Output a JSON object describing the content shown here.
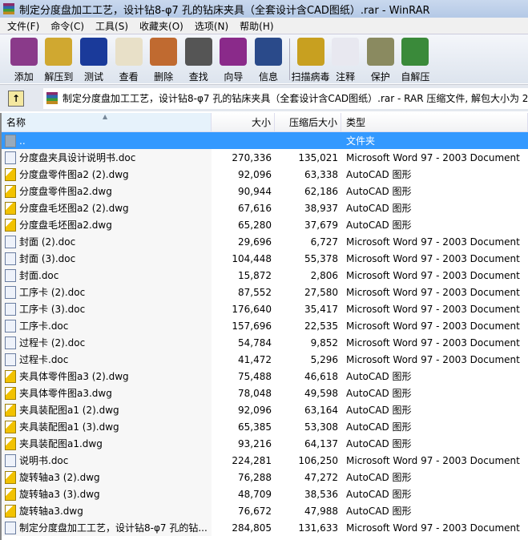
{
  "window": {
    "title": "制定分度盘加工工艺，设计钻8-φ7 孔的钻床夹具（全套设计含CAD图纸）.rar - WinRAR"
  },
  "menu": [
    "文件(F)",
    "命令(C)",
    "工具(S)",
    "收藏夹(O)",
    "选项(N)",
    "帮助(H)"
  ],
  "toolbar": [
    {
      "label": "添加",
      "icon": "add-archive-icon",
      "color": "#8a3a8a"
    },
    {
      "label": "解压到",
      "icon": "extract-icon",
      "color": "#d0a830"
    },
    {
      "label": "测试",
      "icon": "test-icon",
      "color": "#1a3a9a"
    },
    {
      "label": "查看",
      "icon": "view-icon",
      "color": "#e8e0c8"
    },
    {
      "label": "删除",
      "icon": "delete-icon",
      "color": "#c06a30"
    },
    {
      "label": "查找",
      "icon": "find-icon",
      "color": "#555"
    },
    {
      "label": "向导",
      "icon": "wizard-icon",
      "color": "#8a2a8a"
    },
    {
      "label": "信息",
      "icon": "info-icon",
      "color": "#2a4a8a"
    },
    {
      "label": "扫描病毒",
      "icon": "virus-scan-icon",
      "color": "#c8a020"
    },
    {
      "label": "注释",
      "icon": "comment-icon",
      "color": "#e8e8f0"
    },
    {
      "label": "保护",
      "icon": "protect-icon",
      "color": "#8a8a60"
    },
    {
      "label": "自解压",
      "icon": "sfx-icon",
      "color": "#3a8a3a"
    }
  ],
  "address": {
    "text": "制定分度盘加工工艺，设计钻8-φ7 孔的钻床夹具（全套设计含CAD图纸）.rar - RAR 压缩文件, 解包大小为 2"
  },
  "columns": {
    "name": "名称",
    "size": "大小",
    "packed": "压缩后大小",
    "type": "类型"
  },
  "files": [
    {
      "name": "..",
      "size": "",
      "packed": "",
      "type": "文件夹",
      "kind": "dir",
      "selected": true
    },
    {
      "name": "分度盘夹具设计说明书.doc",
      "size": "270,336",
      "packed": "135,021",
      "type": "Microsoft Word 97 - 2003 Document",
      "kind": "doc"
    },
    {
      "name": "分度盘零件图a2 (2).dwg",
      "size": "92,096",
      "packed": "63,338",
      "type": "AutoCAD 图形",
      "kind": "dwg"
    },
    {
      "name": "分度盘零件图a2.dwg",
      "size": "90,944",
      "packed": "62,186",
      "type": "AutoCAD 图形",
      "kind": "dwg"
    },
    {
      "name": "分度盘毛坯图a2 (2).dwg",
      "size": "67,616",
      "packed": "38,937",
      "type": "AutoCAD 图形",
      "kind": "dwg"
    },
    {
      "name": "分度盘毛坯图a2.dwg",
      "size": "65,280",
      "packed": "37,679",
      "type": "AutoCAD 图形",
      "kind": "dwg"
    },
    {
      "name": "封面 (2).doc",
      "size": "29,696",
      "packed": "6,727",
      "type": "Microsoft Word 97 - 2003 Document",
      "kind": "doc"
    },
    {
      "name": "封面 (3).doc",
      "size": "104,448",
      "packed": "55,378",
      "type": "Microsoft Word 97 - 2003 Document",
      "kind": "doc"
    },
    {
      "name": "封面.doc",
      "size": "15,872",
      "packed": "2,806",
      "type": "Microsoft Word 97 - 2003 Document",
      "kind": "doc"
    },
    {
      "name": "工序卡 (2).doc",
      "size": "87,552",
      "packed": "27,580",
      "type": "Microsoft Word 97 - 2003 Document",
      "kind": "doc"
    },
    {
      "name": "工序卡 (3).doc",
      "size": "176,640",
      "packed": "35,417",
      "type": "Microsoft Word 97 - 2003 Document",
      "kind": "doc"
    },
    {
      "name": "工序卡.doc",
      "size": "157,696",
      "packed": "22,535",
      "type": "Microsoft Word 97 - 2003 Document",
      "kind": "doc"
    },
    {
      "name": "过程卡 (2).doc",
      "size": "54,784",
      "packed": "9,852",
      "type": "Microsoft Word 97 - 2003 Document",
      "kind": "doc"
    },
    {
      "name": "过程卡.doc",
      "size": "41,472",
      "packed": "5,296",
      "type": "Microsoft Word 97 - 2003 Document",
      "kind": "doc"
    },
    {
      "name": "夹具体零件图a3 (2).dwg",
      "size": "75,488",
      "packed": "46,618",
      "type": "AutoCAD 图形",
      "kind": "dwg"
    },
    {
      "name": "夹具体零件图a3.dwg",
      "size": "78,048",
      "packed": "49,598",
      "type": "AutoCAD 图形",
      "kind": "dwg"
    },
    {
      "name": "夹具装配图a1 (2).dwg",
      "size": "92,096",
      "packed": "63,164",
      "type": "AutoCAD 图形",
      "kind": "dwg"
    },
    {
      "name": "夹具装配图a1 (3).dwg",
      "size": "65,385",
      "packed": "53,308",
      "type": "AutoCAD 图形",
      "kind": "dwg"
    },
    {
      "name": "夹具装配图a1.dwg",
      "size": "93,216",
      "packed": "64,137",
      "type": "AutoCAD 图形",
      "kind": "dwg"
    },
    {
      "name": "说明书.doc",
      "size": "224,281",
      "packed": "106,250",
      "type": "Microsoft Word 97 - 2003 Document",
      "kind": "doc"
    },
    {
      "name": "旋转轴a3 (2).dwg",
      "size": "76,288",
      "packed": "47,272",
      "type": "AutoCAD 图形",
      "kind": "dwg"
    },
    {
      "name": "旋转轴a3 (3).dwg",
      "size": "48,709",
      "packed": "38,536",
      "type": "AutoCAD 图形",
      "kind": "dwg"
    },
    {
      "name": "旋转轴a3.dwg",
      "size": "76,672",
      "packed": "47,988",
      "type": "AutoCAD 图形",
      "kind": "dwg"
    },
    {
      "name": "制定分度盘加工工艺，设计钻8-φ7 孔的钻...",
      "size": "284,805",
      "packed": "131,633",
      "type": "Microsoft Word 97 - 2003 Document",
      "kind": "doc"
    }
  ]
}
